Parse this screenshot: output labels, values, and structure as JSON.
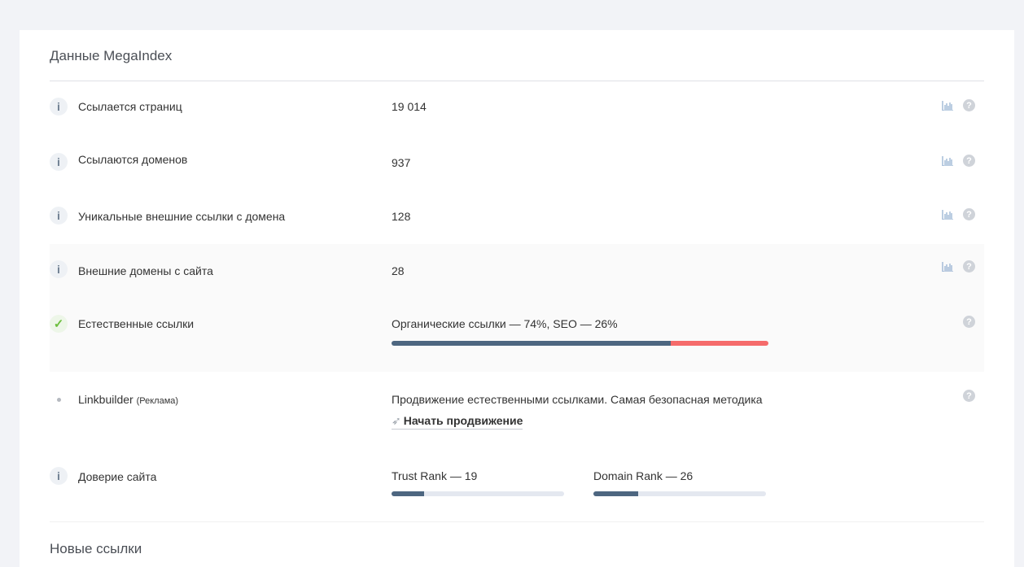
{
  "section": {
    "title": "Данные MegaIndex"
  },
  "rows": [
    {
      "label": "Ссылается страниц",
      "value": "19 014",
      "icon": "info-icon"
    },
    {
      "label": "Ссылаются доменов",
      "value": "937",
      "icon": "info-icon"
    },
    {
      "label": "Уникальные внешние ссылки с домена",
      "value": "128",
      "icon": "info-icon"
    },
    {
      "label": "Внешние домены с сайта",
      "value": "28",
      "icon": "info-icon"
    }
  ],
  "natural_links": {
    "label": "Естественные ссылки",
    "icon": "check-icon",
    "text": "Органические ссылки — 74%, SEO — 26%",
    "organic_percent": 74,
    "seo_percent": 26,
    "colors": {
      "organic": "#4d6680",
      "seo": "#f56b6b"
    }
  },
  "linkbuilder": {
    "label": "Linkbuilder",
    "label_note": "(Реклама)",
    "icon": "dot-icon",
    "text": "Продвижение естественными ссылками. Самая безопасная методика",
    "action": "Начать продвижение",
    "action_icon": "rocket-icon"
  },
  "trust": {
    "label": "Доверие сайта",
    "icon": "info-icon",
    "trust_rank_text": "Trust Rank — 19",
    "trust_rank": 19,
    "domain_rank_text": "Domain Rank — 26",
    "domain_rank": 26
  },
  "next_section": {
    "title": "Новые ссылки"
  },
  "icons": {
    "info": "i",
    "check": "✓",
    "help": "?"
  }
}
